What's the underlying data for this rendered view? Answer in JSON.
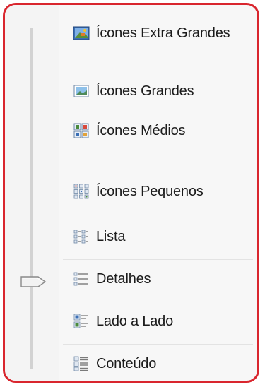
{
  "view_menu": {
    "items": [
      {
        "id": "extra-large",
        "label": "Ícones Extra Grandes",
        "icon": "extra-large-icons-icon"
      },
      {
        "id": "large",
        "label": "Ícones Grandes",
        "icon": "large-icons-icon"
      },
      {
        "id": "medium",
        "label": "Ícones Médios",
        "icon": "medium-icons-icon"
      },
      {
        "id": "small",
        "label": "Ícones Pequenos",
        "icon": "small-icons-icon"
      },
      {
        "id": "list",
        "label": "Lista",
        "icon": "list-icon"
      },
      {
        "id": "details",
        "label": "Detalhes",
        "icon": "details-icon"
      },
      {
        "id": "tiles",
        "label": "Lado a Lado",
        "icon": "tiles-icon"
      },
      {
        "id": "content",
        "label": "Conteúdo",
        "icon": "content-icon"
      }
    ],
    "selected": "Detalhes"
  },
  "colors": {
    "highlight_border": "#d9262e",
    "menu_background": "#f7f7f7",
    "text": "#1b1b1b"
  }
}
